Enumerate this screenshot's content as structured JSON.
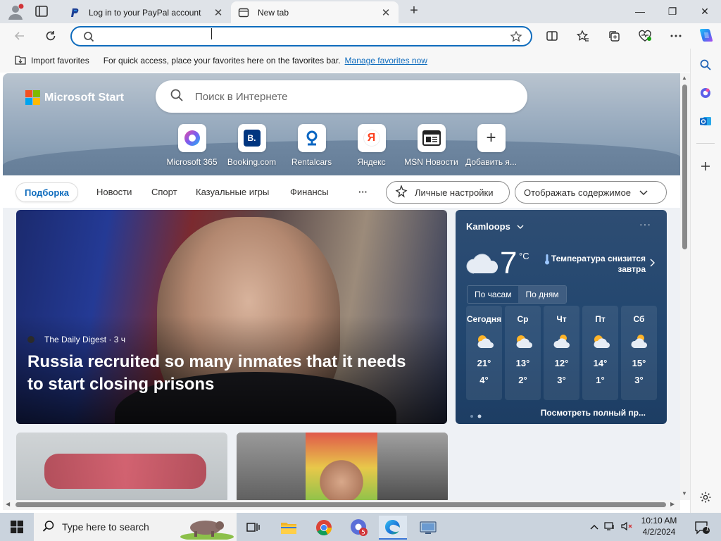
{
  "browser": {
    "tabs": [
      {
        "title": "Log in to your PayPal account",
        "close": "✕"
      },
      {
        "title": "New tab",
        "close": "✕"
      }
    ],
    "new_tab_glyph": "+",
    "window_controls": {
      "minimize": "—",
      "maximize": "❐",
      "close": "✕"
    },
    "address_value": "",
    "favbar": {
      "import_label": "Import favorites",
      "message": "For quick access, place your favorites here on the favorites bar.",
      "manage_link": "Manage favorites now"
    }
  },
  "newtab": {
    "logo_text": "Microsoft Start",
    "search_placeholder": "Поиск в Интернете",
    "quick_links": [
      {
        "label": "Microsoft 365",
        "icon": "microsoft365-icon"
      },
      {
        "label": "Booking.com",
        "icon": "booking-icon",
        "glyph": "B."
      },
      {
        "label": "Rentalcars",
        "icon": "rentalcars-icon"
      },
      {
        "label": "Яндекс",
        "icon": "yandex-icon",
        "glyph": "Я"
      },
      {
        "label": "MSN Новости",
        "icon": "msn-news-icon"
      },
      {
        "label": "Добавить я...",
        "icon": "add-icon",
        "glyph": "+"
      }
    ],
    "feed_nav": {
      "items": [
        "Подборка",
        "Новости",
        "Спорт",
        "Казуальные игры",
        "Финансы"
      ],
      "more": "···",
      "personalize": "Личные настройки",
      "show_content": "Отображать содержимое"
    },
    "main_story": {
      "source": "The Daily Digest · 3 ч",
      "headline": "Russia recruited so many inmates that it needs to start closing prisons"
    },
    "weather": {
      "city": "Kamloops",
      "menu": "···",
      "temp": "7",
      "unit": "°C",
      "note": "Температура снизится завтра",
      "tabs": [
        "По часам",
        "По дням"
      ],
      "days": [
        {
          "name": "Сегодня",
          "hi": "21°",
          "lo": "4°"
        },
        {
          "name": "Ср",
          "hi": "13°",
          "lo": "2°"
        },
        {
          "name": "Чт",
          "hi": "12°",
          "lo": "3°"
        },
        {
          "name": "Пт",
          "hi": "14°",
          "lo": "1°"
        },
        {
          "name": "Сб",
          "hi": "15°",
          "lo": "3°"
        }
      ],
      "more_link": "Посмотреть полный пр..."
    }
  },
  "taskbar": {
    "search_placeholder": "Type here to search",
    "time": "10:10 AM",
    "date": "4/2/2024",
    "notifications": "1"
  },
  "colors": {
    "accent": "#0f6cbd",
    "weather_bg": "#21466f",
    "taskbar": "#cad3dd"
  }
}
